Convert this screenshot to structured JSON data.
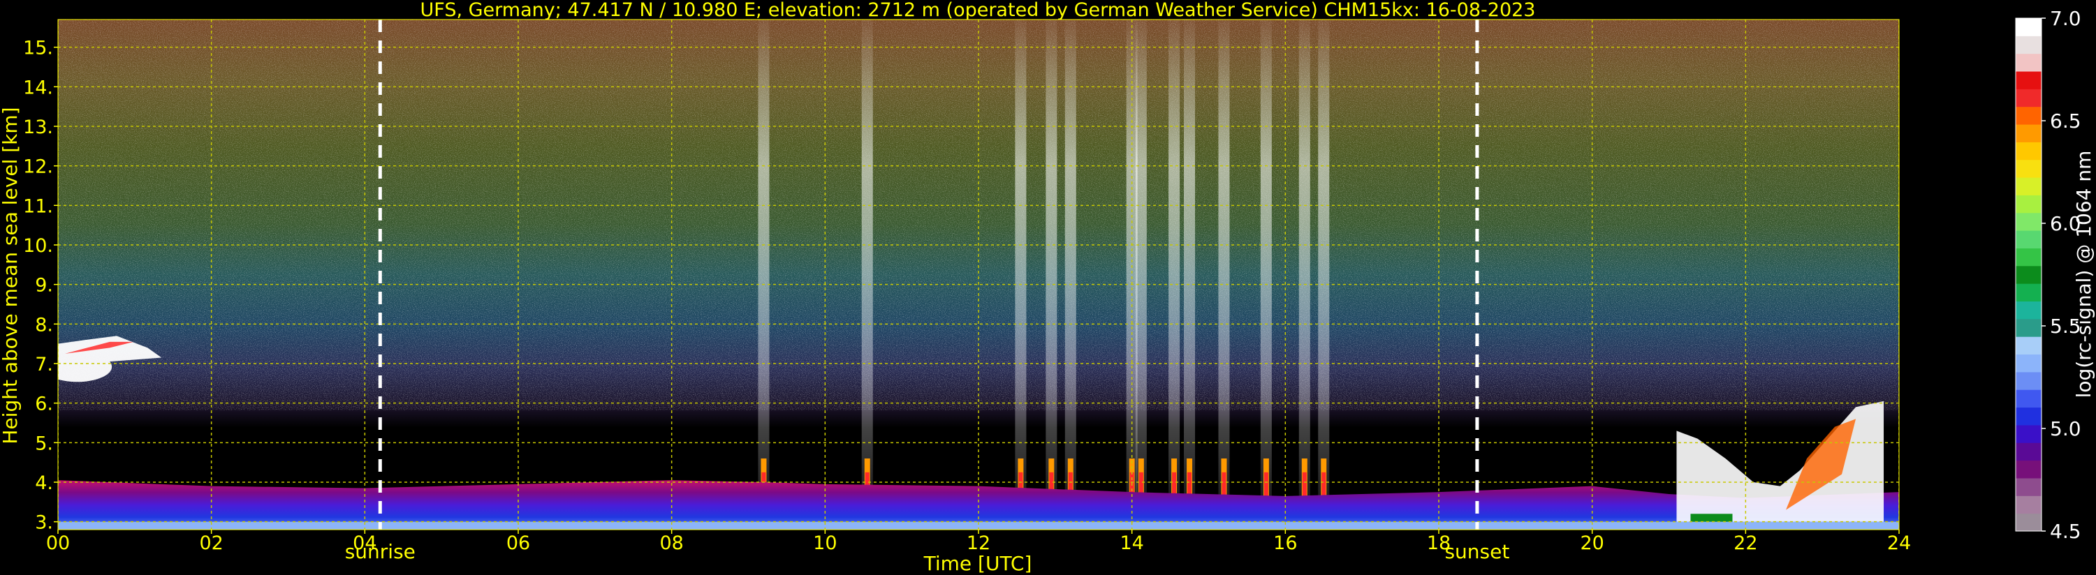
{
  "chart_data": {
    "type": "heatmap",
    "title": "UFS, Germany; 47.417 N / 10.980 E; elevation: 2712 m  (operated by German Weather Service)    CHM15kx: 16-08-2023",
    "xlabel": "Time [UTC]",
    "ylabel": "Height above mean sea level [km]",
    "xlim": [
      0,
      24
    ],
    "ylim": [
      2.8,
      15.7
    ],
    "x_ticks": [
      0,
      2,
      4,
      6,
      8,
      10,
      12,
      14,
      16,
      18,
      20,
      22,
      24
    ],
    "x_tick_labels": [
      "00",
      "02",
      "04",
      "06",
      "08",
      "10",
      "12",
      "14",
      "16",
      "18",
      "20",
      "22",
      "24"
    ],
    "y_ticks": [
      3,
      4,
      5,
      6,
      7,
      8,
      9,
      10,
      11,
      12,
      13,
      14,
      15
    ],
    "y_tick_labels": [
      "3.",
      "4.",
      "5.",
      "6.",
      "7.",
      "8.",
      "9.",
      "10.",
      "11.",
      "12.",
      "13.",
      "14.",
      "15."
    ],
    "grid": true,
    "colorbar": {
      "label": "log(rc-signal) @ 1064 nm",
      "range": [
        4.5,
        7.0
      ],
      "ticks": [
        4.5,
        5.0,
        5.5,
        6.0,
        6.5,
        7.0
      ],
      "tick_labels": [
        "4.5",
        "5.0",
        "5.5",
        "6.0",
        "6.5",
        "7.0"
      ],
      "colors": [
        "#9b8d9a",
        "#a67fa0",
        "#8e4c8e",
        "#77107a",
        "#5a0a96",
        "#3a10c8",
        "#2030e0",
        "#4058f0",
        "#6c8ef5",
        "#8cb4fa",
        "#a8cef8",
        "#2a9c8a",
        "#1cb49c",
        "#14b050",
        "#0c8c1c",
        "#34c446",
        "#58d870",
        "#80e868",
        "#a8f040",
        "#d8f028",
        "#f8e010",
        "#ffc800",
        "#ff9a00",
        "#ff6400",
        "#f02a2a",
        "#e61010",
        "#f2c4c4",
        "#e8e0e0",
        "#ffffff"
      ]
    },
    "sunrise": {
      "x": 4.2,
      "label": "sunrise"
    },
    "sunset": {
      "x": 18.5,
      "label": "sunset"
    },
    "plumes": [
      9.2,
      10.55,
      12.55,
      12.95,
      13.2,
      14.0,
      14.12,
      14.55,
      14.75,
      15.2,
      15.75,
      16.25,
      16.5
    ],
    "cloud_early": {
      "x": [
        0,
        1.35
      ],
      "height": [
        6.5,
        7.8
      ]
    },
    "cloud_late": {
      "x": [
        21.1,
        23.8
      ],
      "height": [
        2.8,
        6.1
      ]
    },
    "colors": {
      "accent": "#ffff00",
      "axis": "#ffff00",
      "grid": "#c8c800",
      "background": "#000000"
    }
  }
}
